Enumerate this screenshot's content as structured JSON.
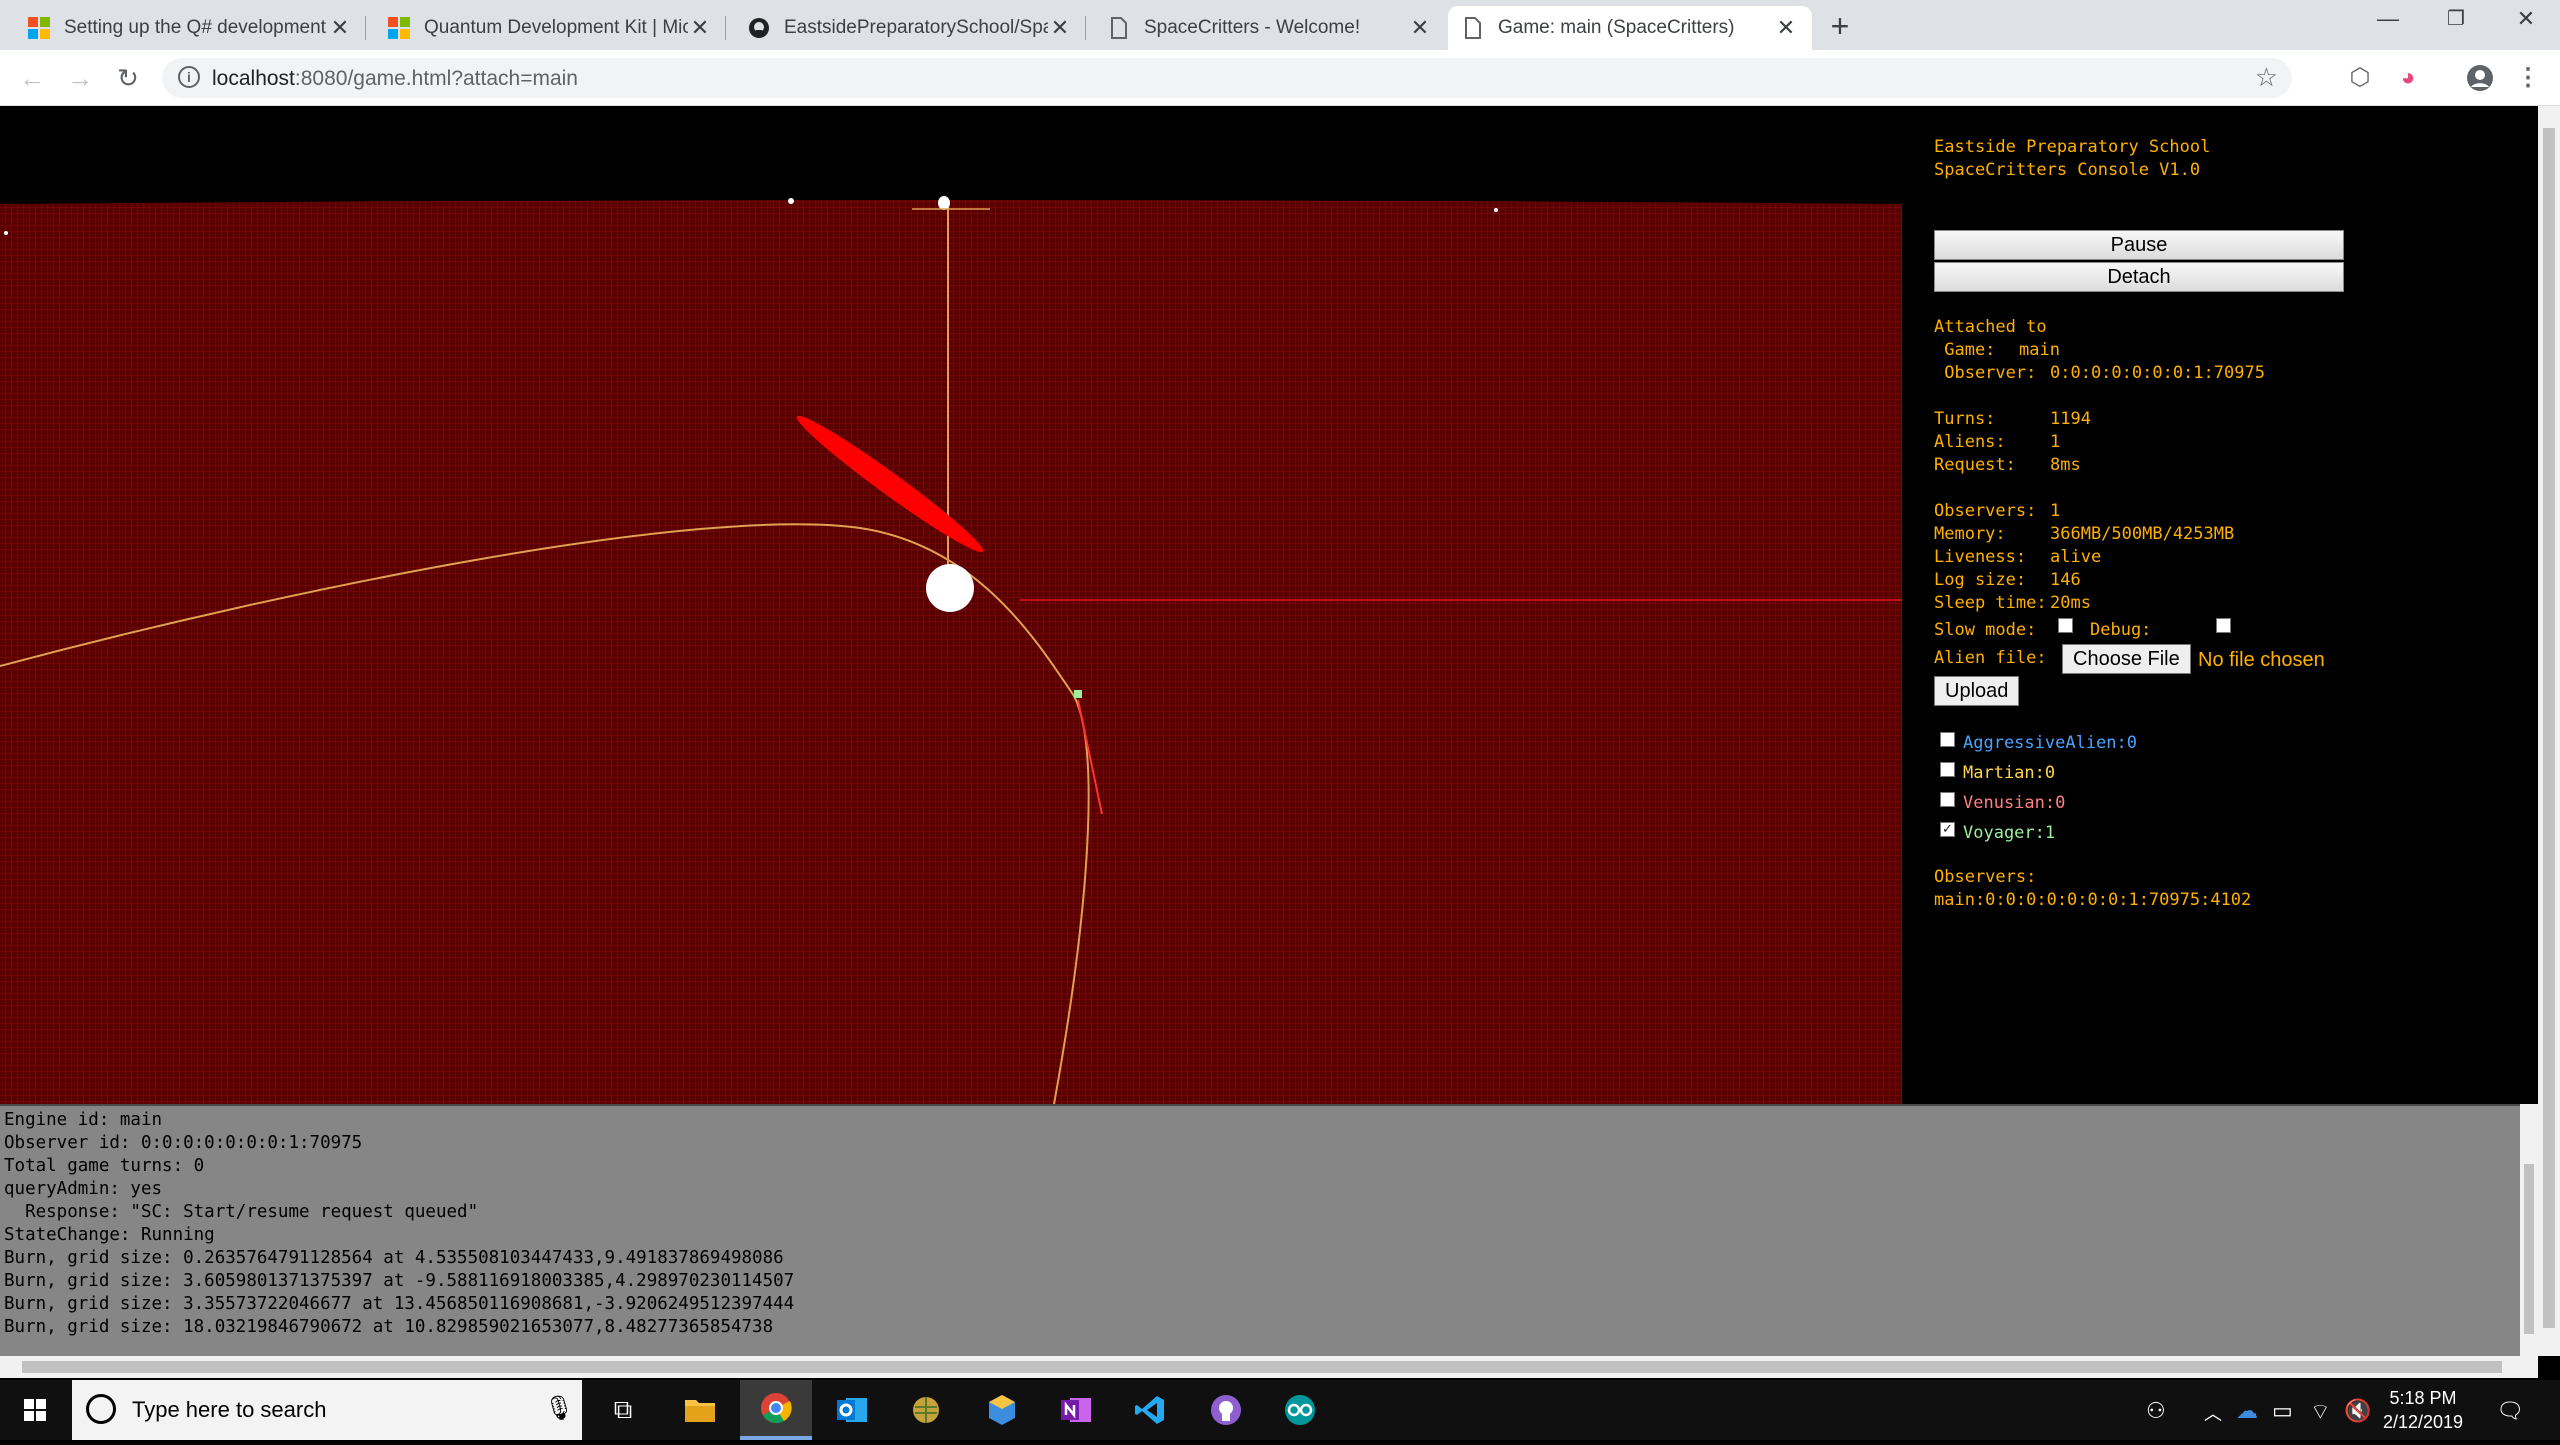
{
  "browser": {
    "tabs": [
      {
        "title": "Setting up the Q# development e",
        "favicon": "microsoft-logo",
        "active": false
      },
      {
        "title": "Quantum Development Kit | Mic",
        "favicon": "microsoft-logo",
        "active": false
      },
      {
        "title": "EastsidePreparatorySchool/Space",
        "favicon": "github-icon",
        "active": false
      },
      {
        "title": "SpaceCritters - Welcome!",
        "favicon": "page-icon",
        "active": false
      },
      {
        "title": "Game: main (SpaceCritters)",
        "favicon": "page-icon",
        "active": true
      }
    ],
    "url_host": "localhost",
    "url_rest": ":8080/game.html?attach=main"
  },
  "console": {
    "header_line1": "Eastside Preparatory School",
    "header_line2": "SpaceCritters Console V1.0",
    "pause_label": "Pause",
    "detach_label": "Detach",
    "attached_to": "Attached to",
    "game_label": " Game:",
    "game_value": "main",
    "observer_label": " Observer:",
    "observer_value": "0:0:0:0:0:0:0:1:70975",
    "turns_label": "Turns:",
    "turns_value": "1194",
    "aliens_label": "Aliens:",
    "aliens_value": "1",
    "request_label": "Request:",
    "request_value": "8ms",
    "observers_label": "Observers:",
    "observers_value": "1",
    "memory_label": "Memory:",
    "memory_value": "366MB/500MB/4253MB",
    "liveness_label": "Liveness:",
    "liveness_value": "alive",
    "logsize_label": "Log size:",
    "logsize_value": "146",
    "sleep_label": "Sleep time:",
    "sleep_value": "20ms",
    "slowmode_label": "Slow mode:",
    "debug_label": "Debug:",
    "alienfile_label": "Alien file:",
    "choose_file_label": "Choose File",
    "no_file_label": "No file chosen",
    "upload_label": "Upload",
    "species": [
      {
        "label": "AggressiveAlien:0",
        "color": "#4aa3ff",
        "checked": false
      },
      {
        "label": "Martian:0",
        "color": "#ffd54a",
        "checked": false
      },
      {
        "label": "Venusian:0",
        "color": "#ff8080",
        "checked": false
      },
      {
        "label": "Voyager:1",
        "color": "#9cf09c",
        "checked": true
      }
    ],
    "observers_list_label": "Observers:",
    "observers_list_value": "main:0:0:0:0:0:0:0:1:70975:4102",
    "text_color": "#ffb000"
  },
  "log": {
    "lines": [
      "Engine id: main",
      "Observer id: 0:0:0:0:0:0:0:1:70975",
      "Total game turns: 0",
      "queryAdmin: yes",
      "  Response: \"SC: Start/resume request queued\"",
      "StateChange: Running",
      "Burn, grid size: 0.2635764791128564 at 4.535508103447433,9.491837869498086",
      "Burn, grid size: 3.6059801371375397 at -9.588116918003385,4.298970230114507",
      "Burn, grid size: 3.35573722046677 at 13.456850116908681,-3.9206249512397444",
      "Burn, grid size: 18.03219846790672 at 10.829859021653077,8.48277365854738"
    ]
  },
  "taskbar": {
    "search_placeholder": "Type here to search",
    "time": "5:18 PM",
    "date": "2/12/2019"
  }
}
